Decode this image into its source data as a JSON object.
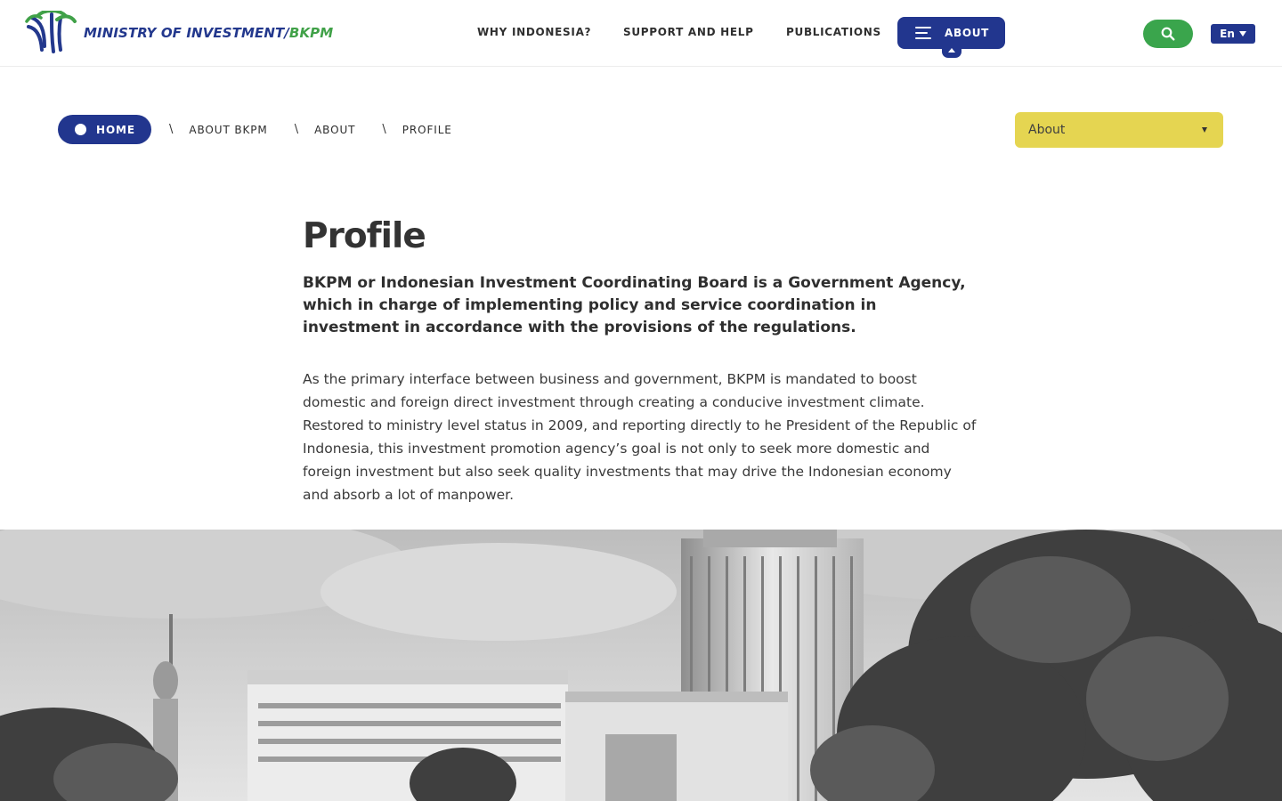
{
  "header": {
    "logo_text_main": "MINISTRY OF INVESTMENT/",
    "logo_text_accent": "BKPM",
    "nav": [
      {
        "label": "WHY INDONESIA?"
      },
      {
        "label": "SUPPORT AND HELP"
      },
      {
        "label": "PUBLICATIONS"
      }
    ],
    "about_label": "ABOUT",
    "search_icon": "search-icon",
    "language": "En",
    "colors": {
      "brand_blue": "#22368e",
      "brand_green": "#3aa54c",
      "dropdown_yellow": "#e5d551"
    }
  },
  "breadcrumb": {
    "items": [
      {
        "label": "HOME"
      },
      {
        "label": "ABOUT BKPM"
      },
      {
        "label": "ABOUT"
      },
      {
        "label": "PROFILE"
      }
    ],
    "separator": "\\"
  },
  "section_select": {
    "selected": "About"
  },
  "main": {
    "title": "Profile",
    "lead": "BKPM or Indonesian Investment Coordinating Board is a Government Agency, which in charge of implementing policy and service coordination in investment in accordance with the provisions of the regulations.",
    "body": "As the primary interface between business and government, BKPM is mandated to boost domestic and foreign direct investment through creating a conducive investment climate. Restored to ministry level status in 2009, and reporting directly to he President of the Republic of Indonesia, this investment promotion agency’s goal is not only to seek more domestic and foreign investment but also seek quality investments that may drive the Indonesian economy and absorb a lot of manpower."
  }
}
